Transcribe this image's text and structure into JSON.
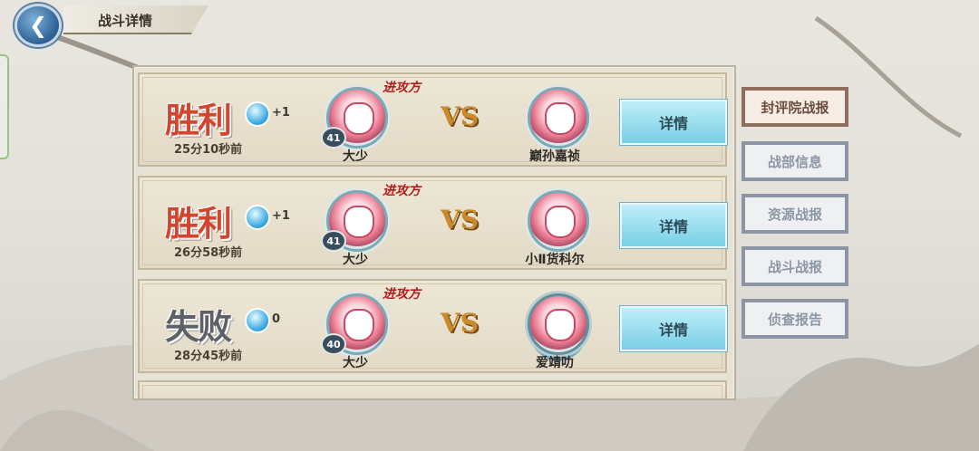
{
  "header": {
    "title": "战斗详情",
    "back_icon": "back-arrow-icon"
  },
  "battles": [
    {
      "result": "胜利",
      "result_type": "win",
      "gem_change": "+1",
      "time": "25分10秒前",
      "attacker_label": "进攻方",
      "attacker": {
        "name": "大少",
        "level": "41"
      },
      "defender": {
        "name": "巅孙嘉祯"
      },
      "detail_label": "详情"
    },
    {
      "result": "胜利",
      "result_type": "win",
      "gem_change": "+1",
      "time": "26分58秒前",
      "attacker_label": "进攻方",
      "attacker": {
        "name": "大少",
        "level": "41"
      },
      "defender": {
        "name": "小Ⅱ货科尔"
      },
      "detail_label": "详情"
    },
    {
      "result": "失败",
      "result_type": "lose",
      "gem_change": "0",
      "time": "28分45秒前",
      "attacker_label": "进攻方",
      "attacker": {
        "name": "大少",
        "level": "40"
      },
      "defender": {
        "name": "爱靖叻"
      },
      "detail_label": "详情"
    }
  ],
  "vs_text": "VS",
  "side_menu": [
    {
      "label": "封评院战报",
      "active": true
    },
    {
      "label": "战部信息",
      "active": false
    },
    {
      "label": "资源战报",
      "active": false
    },
    {
      "label": "战斗战报",
      "active": false
    },
    {
      "label": "侦查报告",
      "active": false
    }
  ],
  "colors": {
    "win": "#d2452e",
    "lose": "#5d6066",
    "detail_button": "#79cfe6",
    "active_tab": "#8e6e5c"
  }
}
